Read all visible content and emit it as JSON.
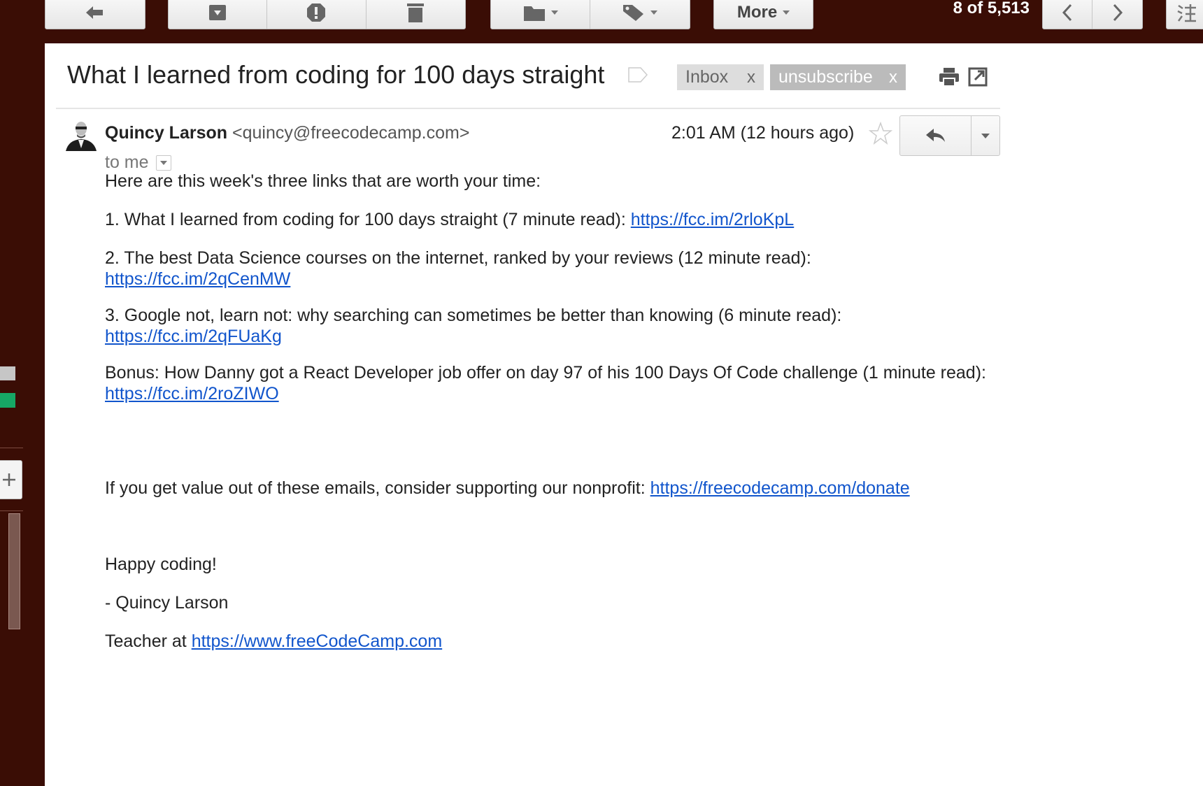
{
  "toolbar": {
    "more_label": "More",
    "counter": "8 of 5,513"
  },
  "email": {
    "subject": "What I learned from coding for 100 days straight",
    "labels": [
      {
        "name": "Inbox",
        "remove": "x"
      },
      {
        "name": "unsubscribe",
        "remove": "x"
      }
    ],
    "sender_name": "Quincy Larson",
    "sender_email": "<quincy@freecodecamp.com>",
    "recipient": "to me",
    "timestamp": "2:01 AM (12 hours ago)"
  },
  "body": {
    "intro": "Here are this week's three links that are worth your time:",
    "items": [
      {
        "text": "1. What I learned from coding for 100 days straight (7 minute read): ",
        "link": "https://fcc.im/2rloKpL"
      },
      {
        "text": "2. The best Data Science courses on the internet, ranked by your reviews (12 minute read):",
        "link": "https://fcc.im/2qCenMW"
      },
      {
        "text": "3. Google not, learn not: why searching can sometimes be better than knowing (6 minute read):",
        "link": "https://fcc.im/2qFUaKg"
      },
      {
        "text": "Bonus: How Danny got a React Developer job offer on day 97 of his 100 Days Of Code challenge (1 minute read): ",
        "link": "https://fcc.im/2roZIWO"
      }
    ],
    "donate_text": "If you get value out of these emails, consider supporting our nonprofit: ",
    "donate_link": "https://freecodecamp.com/donate",
    "closing": "Happy coding!",
    "signature": "- Quincy Larson",
    "teacher_text": "Teacher at ",
    "teacher_link": "https://www.freeCodeCamp.com"
  },
  "icons": [
    "back-arrow-icon",
    "archive-icon",
    "report-spam-icon",
    "delete-icon",
    "folder-icon",
    "label-icon",
    "chevron-left-icon",
    "chevron-right-icon",
    "input-tools-icon",
    "print-icon",
    "new-window-icon",
    "star-icon",
    "reply-icon"
  ],
  "colors": {
    "frame": "#3a0d05",
    "link": "#1155cc",
    "inbox_chip": "#dddddd",
    "unsubscribe_chip": "#bbbbbb",
    "sidebar_green": "#16a765"
  }
}
